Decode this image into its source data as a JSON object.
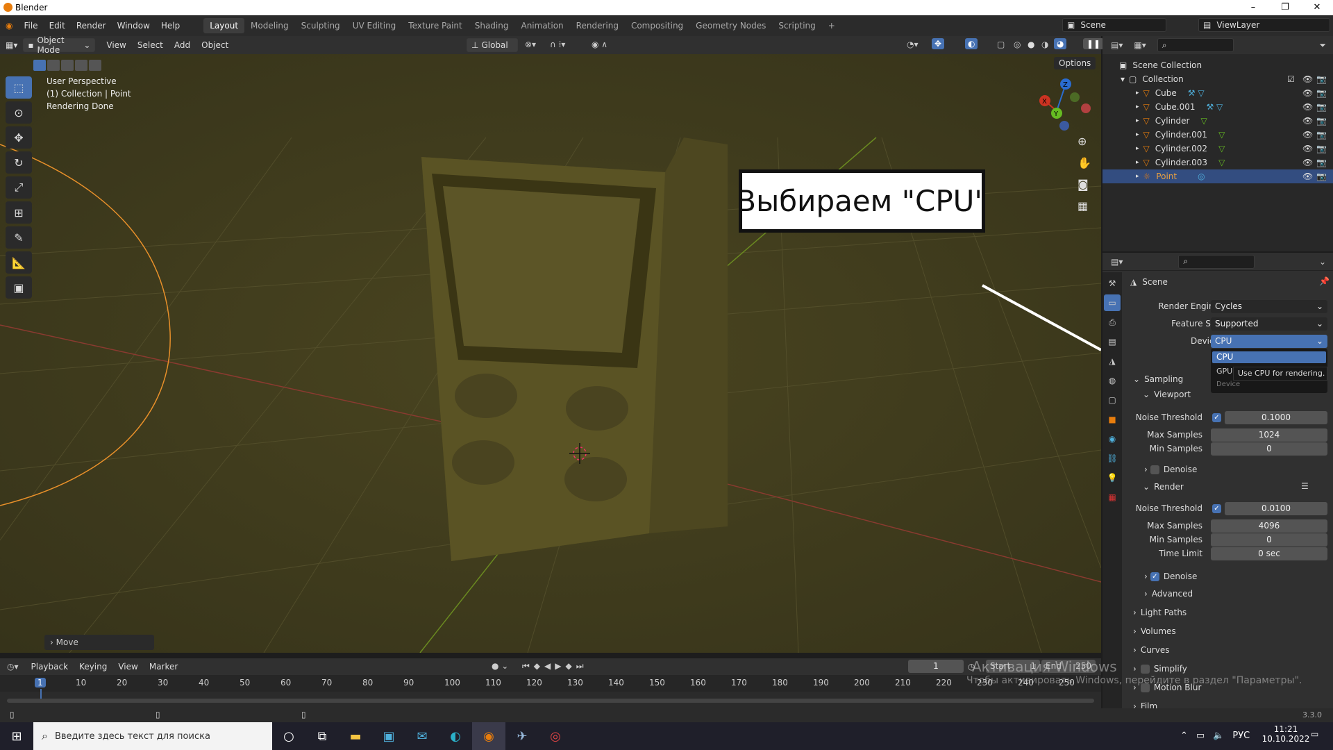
{
  "window": {
    "title": "Blender",
    "minimize": "–",
    "maximize": "❐",
    "close": "✕"
  },
  "menu": [
    "File",
    "Edit",
    "Render",
    "Window",
    "Help"
  ],
  "workspaces": [
    "Layout",
    "Modeling",
    "Sculpting",
    "UV Editing",
    "Texture Paint",
    "Shading",
    "Animation",
    "Rendering",
    "Compositing",
    "Geometry Nodes",
    "Scripting",
    "+"
  ],
  "scene_name": "Scene",
  "view_layer": "ViewLayer",
  "viewport_header": {
    "mode": "Object Mode",
    "menus": [
      "View",
      "Select",
      "Add",
      "Object"
    ],
    "transform": "Global",
    "options": "Options"
  },
  "viewport_info": {
    "line1": "User Perspective",
    "line2": "(1) Collection | Point",
    "line3": "Rendering Done"
  },
  "operator_panel": "Move",
  "annotation": "Выбираем \"CPU\"",
  "outliner": {
    "root": "Scene Collection",
    "collection": "Collection",
    "items": [
      {
        "name": "Cube",
        "selected": false
      },
      {
        "name": "Cube.001",
        "selected": false
      },
      {
        "name": "Cylinder",
        "selected": false
      },
      {
        "name": "Cylinder.001",
        "selected": false
      },
      {
        "name": "Cylinder.002",
        "selected": false
      },
      {
        "name": "Cylinder.003",
        "selected": false
      },
      {
        "name": "Point",
        "selected": true
      }
    ]
  },
  "properties": {
    "context": "Scene",
    "render_engine_label": "Render Engine",
    "render_engine": "Cycles",
    "feature_set_label": "Feature Set",
    "feature_set": "Supported",
    "device_label": "Device",
    "device": "CPU",
    "device_options": [
      "CPU",
      "GPU Compute"
    ],
    "tooltip": "Use CPU for rendering.",
    "tooltip_sub": "Device",
    "sampling": "Sampling",
    "viewport": "Viewport",
    "vp_noise_label": "Noise Threshold",
    "vp_noise": "0.1000",
    "vp_max_label": "Max Samples",
    "vp_max": "1024",
    "vp_min_label": "Min Samples",
    "vp_min": "0",
    "vp_denoise": "Denoise",
    "render": "Render",
    "r_noise_label": "Noise Threshold",
    "r_noise": "0.0100",
    "r_max_label": "Max Samples",
    "r_max": "4096",
    "r_min_label": "Min Samples",
    "r_min": "0",
    "r_time_label": "Time Limit",
    "r_time": "0 sec",
    "r_denoise": "Denoise",
    "advanced": "Advanced",
    "panels": [
      "Light Paths",
      "Volumes",
      "Curves",
      "Simplify",
      "Motion Blur",
      "Film"
    ]
  },
  "timeline": {
    "menus": [
      "Playback",
      "Keying",
      "View",
      "Marker"
    ],
    "current_frame": "1",
    "start_label": "Start",
    "start": "1",
    "end_label": "End",
    "end": "250",
    "ticks": [
      "1",
      "10",
      "20",
      "30",
      "40",
      "50",
      "60",
      "70",
      "80",
      "90",
      "100",
      "110",
      "120",
      "130",
      "140",
      "150",
      "160",
      "170",
      "180",
      "190",
      "200",
      "210",
      "220",
      "230",
      "240",
      "250"
    ]
  },
  "watermark": {
    "line1": "Активация Windows",
    "line2": "Чтобы активировать Windows, перейдите в раздел \"Параметры\"."
  },
  "version": "3.3.0",
  "taskbar": {
    "search_placeholder": "Введите здесь текст для поиска",
    "lang": "РУС",
    "time": "11:21",
    "date": "10.10.2022"
  }
}
